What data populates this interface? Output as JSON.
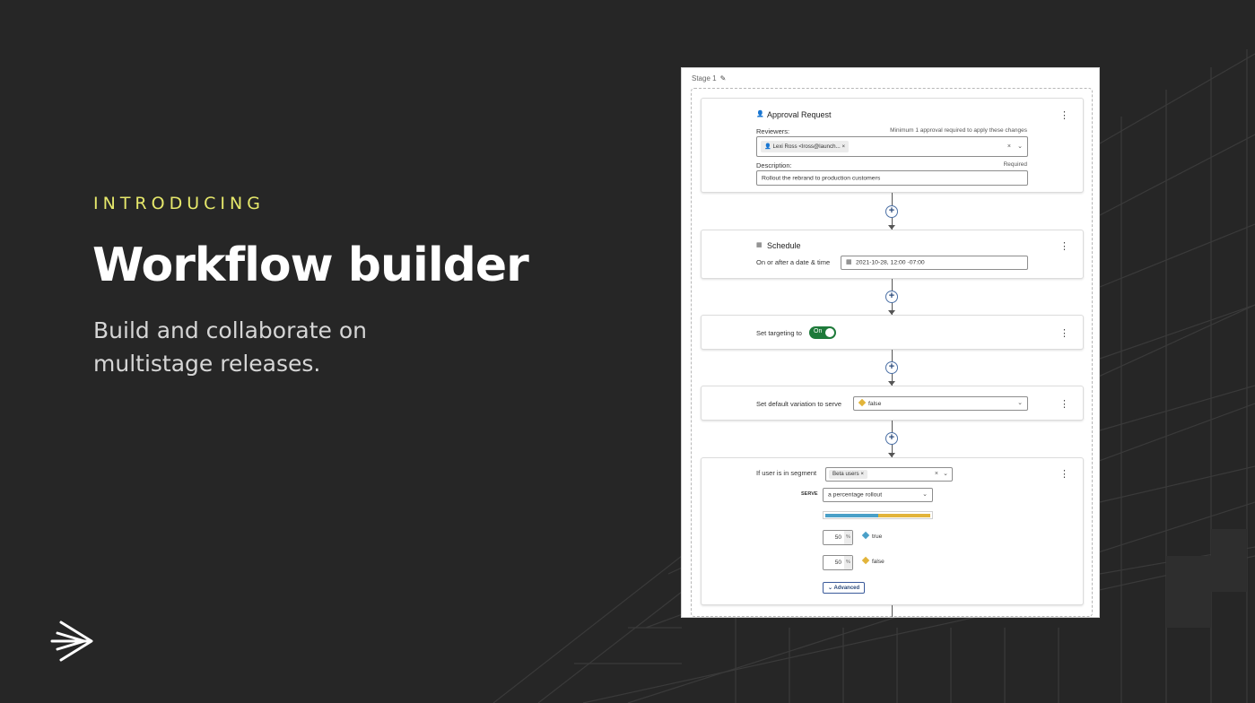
{
  "hero": {
    "eyebrow": "INTRODUCING",
    "title": "Workflow builder",
    "subtitle": "Build and collaborate on multistage releases."
  },
  "colors": {
    "background": "#262626",
    "eyebrow": "#e6e86b",
    "true_variation": "#4aa0c8",
    "false_variation": "#e2b43a",
    "toggle_on": "#1e7a3a"
  },
  "workflow": {
    "stage_label": "Stage 1",
    "approval": {
      "title": "Approval Request",
      "reviewers_label": "Reviewers:",
      "reviewers_note": "Minimum 1 approval required to apply these changes",
      "reviewer_chip": "Lexi Ross <lross@launch...",
      "description_label": "Description:",
      "description_required": "Required",
      "description_value": "Rollout the rebrand to production customers"
    },
    "schedule": {
      "title": "Schedule",
      "label": "On or after a date & time",
      "value": "2021-10-28, 12:00 -07:00"
    },
    "targeting": {
      "label": "Set targeting to",
      "toggle_label": "On"
    },
    "default_variation": {
      "label": "Set default variation to serve",
      "value": "false"
    },
    "segment": {
      "label": "If user is in segment",
      "chip": "Beta users",
      "serve_label": "SERVE",
      "serve_value": "a percentage rollout",
      "rollout": [
        {
          "percent": "50",
          "unit": "%",
          "variation": "true",
          "share": 0.5
        },
        {
          "percent": "50",
          "unit": "%",
          "variation": "false",
          "share": 0.5
        }
      ],
      "advanced_label": "Advanced"
    }
  }
}
